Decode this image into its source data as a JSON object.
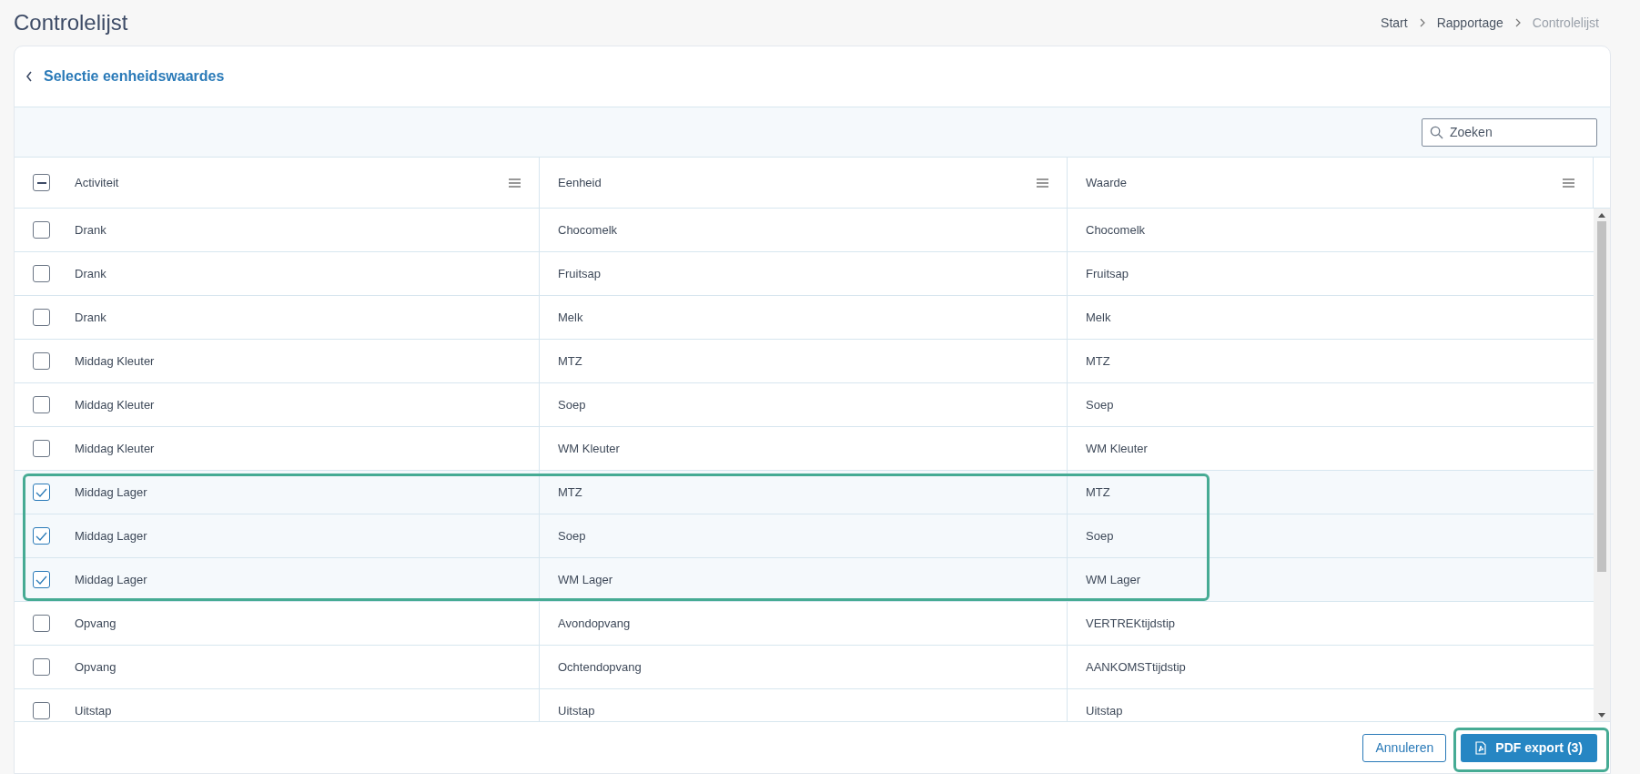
{
  "page_title": "Controlelijst",
  "breadcrumbs": [
    {
      "label": "Start",
      "current": false
    },
    {
      "label": "Rapportage",
      "current": false
    },
    {
      "label": "Controlelijst",
      "current": true
    }
  ],
  "card": {
    "back_link": "Selectie eenheidswaardes",
    "search": {
      "placeholder": "Zoeken"
    }
  },
  "table": {
    "select_all": {
      "indeterminate": true
    },
    "columns": [
      "Activiteit",
      "Eenheid",
      "Waarde"
    ],
    "rows": [
      {
        "cells": [
          "Drank",
          "Chocomelk",
          "Chocomelk"
        ],
        "checked": false
      },
      {
        "cells": [
          "Drank",
          "Fruitsap",
          "Fruitsap"
        ],
        "checked": false
      },
      {
        "cells": [
          "Drank",
          "Melk",
          "Melk"
        ],
        "checked": false
      },
      {
        "cells": [
          "Middag Kleuter",
          "MTZ",
          "MTZ"
        ],
        "checked": false
      },
      {
        "cells": [
          "Middag Kleuter",
          "Soep",
          "Soep"
        ],
        "checked": false
      },
      {
        "cells": [
          "Middag Kleuter",
          "WM Kleuter",
          "WM Kleuter"
        ],
        "checked": false
      },
      {
        "cells": [
          "Middag Lager",
          "MTZ",
          "MTZ"
        ],
        "checked": true
      },
      {
        "cells": [
          "Middag Lager",
          "Soep",
          "Soep"
        ],
        "checked": true
      },
      {
        "cells": [
          "Middag Lager",
          "WM Lager",
          "WM Lager"
        ],
        "checked": true
      },
      {
        "cells": [
          "Opvang",
          "Avondopvang",
          "VERTREKtijdstip"
        ],
        "checked": false
      },
      {
        "cells": [
          "Opvang",
          "Ochtendopvang",
          "AANKOMSTtijdstip"
        ],
        "checked": false
      },
      {
        "cells": [
          "Uitstap",
          "Uitstap",
          "Uitstap"
        ],
        "checked": false
      }
    ]
  },
  "footer": {
    "cancel_button": "Annuleren",
    "export_button": "PDF export (3)"
  }
}
